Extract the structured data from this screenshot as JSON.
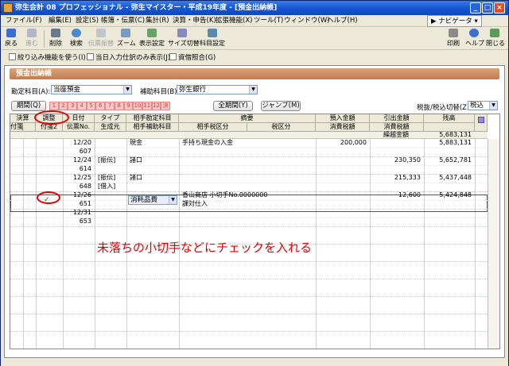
{
  "app": {
    "title": "弥生会計 08 プロフェッショナル - 弥生マイスター・平成19年度 - [預金出納帳]"
  },
  "menus": [
    "ファイル(F)",
    "編集(E)",
    "設定(S)",
    "帳簿・伝票(C)",
    "集計(R)",
    "決算・申告(K)",
    "拡張機能(X)",
    "ツール(T)",
    "ウィンドウ(W)",
    "ヘルプ(H)"
  ],
  "navi_label": "ナビゲータ",
  "toolbar": {
    "left": [
      "戻る",
      "進む",
      "削除",
      "検索",
      "伝票振替",
      "ズーム",
      "表示設定",
      "サイズ切替",
      "科目設定"
    ],
    "right": [
      "印刷",
      "ヘルプ",
      "閉じる"
    ]
  },
  "options": [
    "絞り込み機能を使う(I)",
    "当日入力仕訳のみ表示(J)",
    "資借照合(G)"
  ],
  "section_title": "預金出納帳",
  "filter": {
    "account_label": "勘定科目(A):",
    "account_value": "当座預金",
    "sub_label": "補助科目(B):",
    "sub_value": "弥生銀行"
  },
  "period_btn": "期間(Q)",
  "months": [
    "1",
    "2",
    "3",
    "4",
    "5",
    "6",
    "7",
    "8",
    "9",
    "10",
    "11",
    "12",
    "決"
  ],
  "all_period_btn": "全期間(Y)",
  "jump_btn": "ジャンプ(M)",
  "tax_mode": {
    "label": "税抜/税込切替(Z)",
    "value": "税込"
  },
  "headers": {
    "kessan": "決算",
    "chosei": "調整",
    "date": "日付",
    "type": "タイプ",
    "aite": "相手勘定科目",
    "tekiyo": "摘要",
    "deposit": "預入金額",
    "withdraw": "引出金額",
    "balance": "残高",
    "fusen1": "付箋1",
    "fusen2": "付箋2",
    "denpyo": "伝票No.",
    "source": "生成元",
    "aite_sub": "相手補助科目",
    "aite_tax": "相手税区分",
    "tax": "税区分",
    "deposit_tax": "消費税額",
    "withdraw_tax": "消費税額"
  },
  "carry": {
    "label": "繰越金額",
    "balance": "5,683,131"
  },
  "rows": [
    {
      "date": "12/20",
      "no": "607",
      "type": "",
      "source": "",
      "aite": "現金",
      "memo": "手持ち現金の入金",
      "memo2": "",
      "dep": "200,000",
      "wd": "",
      "bal": "5,883,131"
    },
    {
      "date": "12/24",
      "no": "614",
      "type": "[振伝]",
      "source": "",
      "aite": "諸口",
      "memo": "",
      "memo2": "",
      "dep": "",
      "wd": "230,350",
      "bal": "5,652,781"
    },
    {
      "date": "12/25",
      "no": "648",
      "type": "[振伝]",
      "source": "[借入]",
      "aite": "諸口",
      "memo": "",
      "memo2": "",
      "dep": "",
      "wd": "215,333",
      "bal": "5,437,448"
    },
    {
      "date": "12/26",
      "no": "651",
      "type": "",
      "source": "",
      "aite": "消耗品費",
      "memo": "香山商店 小切手No.0000000",
      "memo2": "課対仕入",
      "dep": "",
      "wd": "12,600",
      "bal": "5,424,848"
    },
    {
      "date": "12/31",
      "no": "653",
      "type": "",
      "source": "",
      "aite": "",
      "memo": "",
      "memo2": "",
      "dep": "",
      "wd": "",
      "bal": ""
    }
  ],
  "check_mark": "✓",
  "annotation": "未落ちの小切手などにチェックを入れる"
}
